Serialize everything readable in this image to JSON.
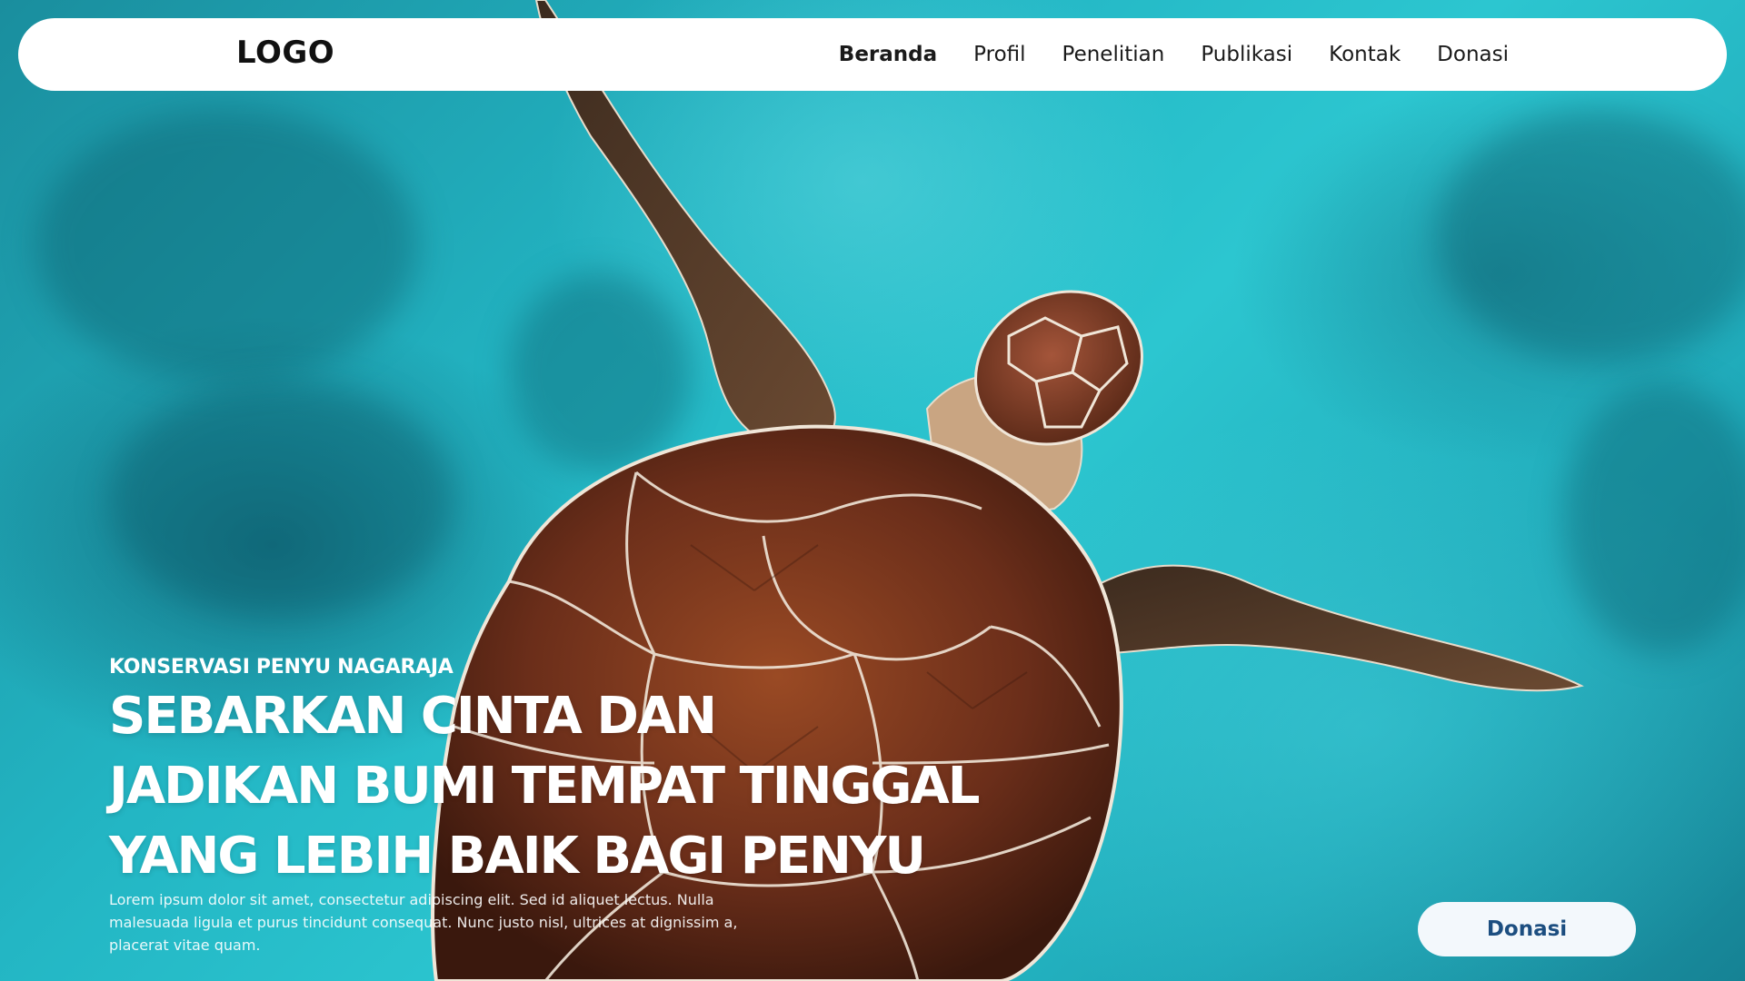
{
  "navbar": {
    "logo": "LOGO",
    "links": [
      "Beranda",
      "Profil",
      "Penelitian",
      "Publikasi",
      "Kontak",
      "Donasi"
    ],
    "active": "Beranda"
  },
  "hero": {
    "eyebrow": "KONSERVASI PENYU NAGARAJA",
    "headline_lines": [
      "SEBARKAN CINTA DAN",
      "JADIKAN BUMI TEMPAT TINGGAL",
      "YANG LEBIH BAIK BAGI PENYU"
    ],
    "body": "Lorem ipsum dolor sit amet, consectetur adipiscing elit. Sed id aliquet lectus. Nulla malesuada ligula et purus tincidunt consequat. Nunc justo nisl, ultrices at dignissim a, placerat vitae quam.",
    "cta_label": "Donasi",
    "background_image": "sea-turtle-underwater-photo"
  },
  "colors": {
    "water": "#23b6c4",
    "navbar_bg": "#ffffff",
    "cta_bg": "#f3f8fc",
    "cta_text": "#1c4e80",
    "shell": "#6b2e1a"
  }
}
